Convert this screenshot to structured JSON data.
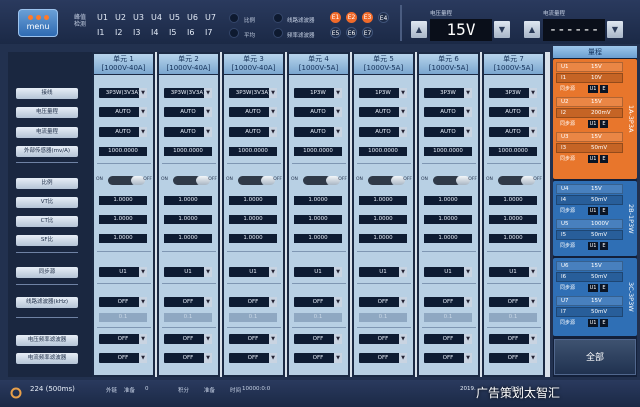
{
  "top": {
    "menu_label": "menu",
    "channel_label": "",
    "channels_u": [
      "U1",
      "U2",
      "U3",
      "U4",
      "U5",
      "U6",
      "U7"
    ],
    "channels_i": [
      "I1",
      "I2",
      "I3",
      "I4",
      "I5",
      "I6",
      "I7"
    ],
    "ratio_label": "比例",
    "avg_label": "平均",
    "line_filter_label": "线路滤波器",
    "freq_filter_label": "频率滤波器",
    "e_top": [
      "E1",
      "E2",
      "E3",
      "E4"
    ],
    "e_bottom": [
      "E5",
      "E6",
      "E7"
    ],
    "voltage_range_label": "电压量程",
    "voltage_range_value": "15V",
    "current_range_label": "电流量程",
    "current_range_value": "------",
    "arrow_up": "▲",
    "arrow_down": "▼"
  },
  "row_labels": [
    "接线",
    "电压量程",
    "电流量程",
    "外部传感器(mv/A)",
    "比例",
    "VT比",
    "CT比",
    "SF比",
    "同步源",
    "线路滤波器(kHz)",
    "电压频率滤波器",
    "电流频率滤波器"
  ],
  "units": [
    {
      "title": "单元 1",
      "spec": "[1000V-40A]",
      "wiring": "3P3W(3V3A)",
      "vr": "AUTO",
      "ir": "AUTO",
      "ext": "1000.0000",
      "vt": "1.0000",
      "ct": "1.0000",
      "sf": "1.0000",
      "sync": "U1",
      "filter": "OFF",
      "filter_val": "0.1",
      "vff": "OFF",
      "iff": "OFF"
    },
    {
      "title": "单元 2",
      "spec": "[1000V-40A]",
      "wiring": "3P3W(3V3A)",
      "vr": "AUTO",
      "ir": "AUTO",
      "ext": "1000.0000",
      "vt": "1.0000",
      "ct": "1.0000",
      "sf": "1.0000",
      "sync": "U1",
      "filter": "OFF",
      "filter_val": "0.1",
      "vff": "OFF",
      "iff": "OFF"
    },
    {
      "title": "单元 3",
      "spec": "[1000V-40A]",
      "wiring": "3P3W(3V3A)",
      "vr": "AUTO",
      "ir": "AUTO",
      "ext": "1000.0000",
      "vt": "1.0000",
      "ct": "1.0000",
      "sf": "1.0000",
      "sync": "U1",
      "filter": "OFF",
      "filter_val": "0.1",
      "vff": "OFF",
      "iff": "OFF"
    },
    {
      "title": "单元 4",
      "spec": "[1000V-5A]",
      "wiring": "1P3W",
      "vr": "AUTO",
      "ir": "AUTO",
      "ext": "1000.0000",
      "vt": "1.0000",
      "ct": "1.0000",
      "sf": "1.0000",
      "sync": "U1",
      "filter": "OFF",
      "filter_val": "0.1",
      "vff": "OFF",
      "iff": "OFF"
    },
    {
      "title": "单元 5",
      "spec": "[1000V-5A]",
      "wiring": "1P3W",
      "vr": "AUTO",
      "ir": "AUTO",
      "ext": "1000.0000",
      "vt": "1.0000",
      "ct": "1.0000",
      "sf": "1.0000",
      "sync": "U1",
      "filter": "OFF",
      "filter_val": "0.1",
      "vff": "OFF",
      "iff": "OFF"
    },
    {
      "title": "单元 6",
      "spec": "[1000V-5A]",
      "wiring": "3P3W",
      "vr": "AUTO",
      "ir": "AUTO",
      "ext": "1000.0000",
      "vt": "1.0000",
      "ct": "1.0000",
      "sf": "1.0000",
      "sync": "U1",
      "filter": "OFF",
      "filter_val": "0.1",
      "vff": "OFF",
      "iff": "OFF"
    },
    {
      "title": "单元 7",
      "spec": "[1000V-5A]",
      "wiring": "3P3W",
      "vr": "AUTO",
      "ir": "AUTO",
      "ext": "1000.0000",
      "vt": "1.0000",
      "ct": "1.0000",
      "sf": "1.0000",
      "sync": "U1",
      "filter": "OFF",
      "filter_val": "0.1",
      "vff": "OFF",
      "iff": "OFF"
    }
  ],
  "toggle_on": "ON",
  "toggle_off": "OFF",
  "right_panel": {
    "title": "量程",
    "group1_name": "1A-3P3A",
    "group2_name": "2B-1P3W",
    "group3_name": "3C-3P3W",
    "g1": [
      [
        "U1",
        "15V"
      ],
      [
        "I1",
        "10V"
      ],
      [
        "U2",
        "15V"
      ],
      [
        "I2",
        "200mV"
      ],
      [
        "U3",
        "15V"
      ],
      [
        "I3",
        "50mV"
      ]
    ],
    "g2": [
      [
        "U4",
        "15V"
      ],
      [
        "I4",
        "50mV"
      ],
      [
        "U5",
        "1000V"
      ],
      [
        "I5",
        "50mV"
      ]
    ],
    "g3": [
      [
        "U6",
        "15V"
      ],
      [
        "I6",
        "50mV"
      ],
      [
        "U7",
        "15V"
      ],
      [
        "I7",
        "50mV"
      ]
    ],
    "sync_label": "同步源",
    "sync_u": "U1",
    "sync_e": "E",
    "sub_auto": "AUTO",
    "all_button": "全部"
  },
  "status": {
    "count": "224 (500ms)",
    "label1": "外链",
    "label1_val": "准备",
    "label1_num": "0",
    "label2": "积分",
    "label2_val": "准备",
    "time_label": "时间",
    "time_val": "10000:0:0",
    "date": "2019.",
    "clock": "9:14"
  },
  "watermark": "广告策划太智汇",
  "colors": {
    "accent_orange": "#f06a2a",
    "header_blue": "#7aa6cf",
    "panel_dark": "#1b2a44"
  }
}
